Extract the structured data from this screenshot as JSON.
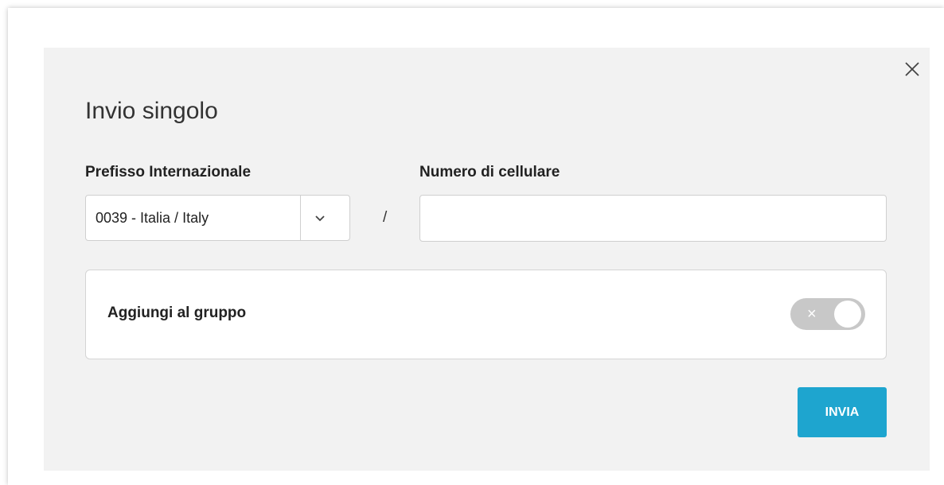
{
  "dialog": {
    "title": "Invio singolo"
  },
  "prefix": {
    "label": "Prefisso Internazionale",
    "selected": "0039 - Italia / Italy"
  },
  "separator": "/",
  "phone": {
    "label": "Numero di cellulare",
    "value": "",
    "placeholder": ""
  },
  "group": {
    "label": "Aggiungi al gruppo",
    "toggle_on": false,
    "toggle_icon": "×"
  },
  "actions": {
    "send_label": "INVIA"
  },
  "colors": {
    "accent": "#1ea5cf",
    "dialog_bg": "#f2f2f2",
    "toggle_off": "#c8c8c8"
  },
  "icons": {
    "close": "close-icon",
    "dropdown": "chevron-down-icon"
  }
}
